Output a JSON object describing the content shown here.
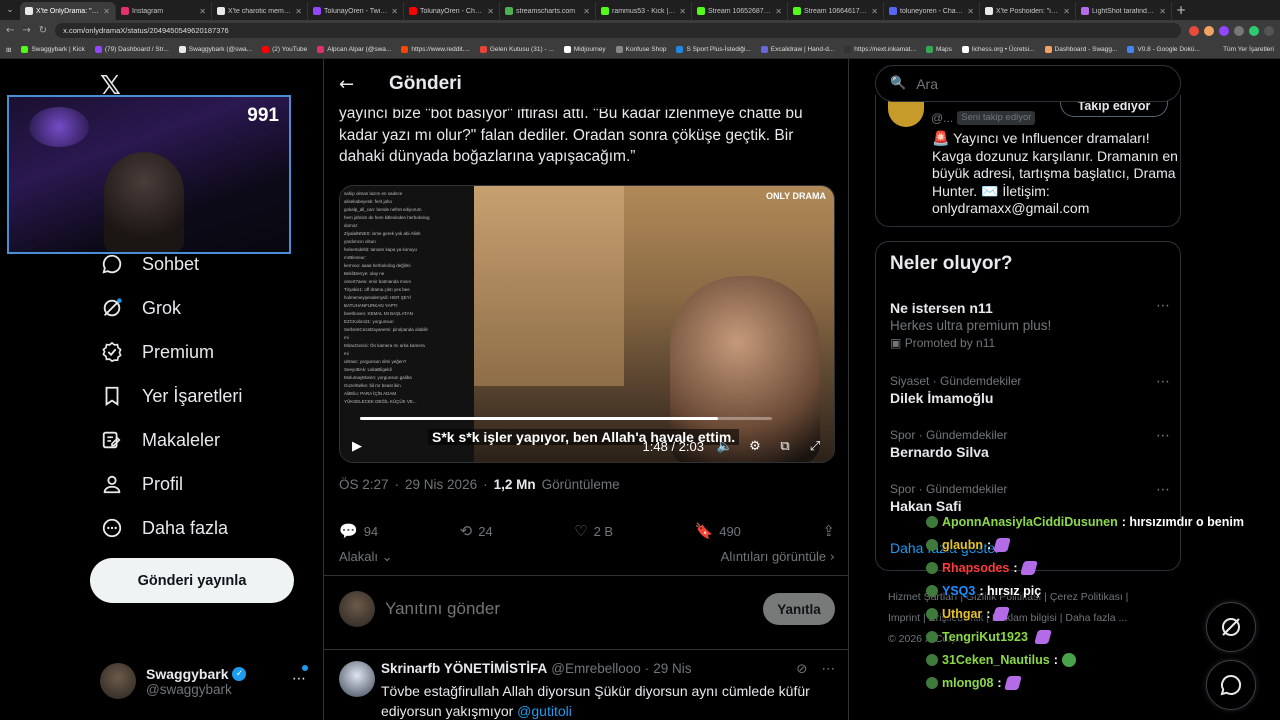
{
  "browser": {
    "tabs": [
      {
        "title": "X'te OnlyDrama: \"Tolu...",
        "color": "#e7e9ea",
        "active": true
      },
      {
        "title": "Instagram",
        "color": "#e1306c"
      },
      {
        "title": "X'te charotic memesi \"P...",
        "color": "#e7e9ea"
      },
      {
        "title": "TolunayOren - Twitch",
        "color": "#9146ff"
      },
      {
        "title": "TolunayOren - Channel",
        "color": "#ff0000"
      },
      {
        "title": "streamscharts.com",
        "color": "#4caf50"
      },
      {
        "title": "rammus53 - Kick | Stre...",
        "color": "#53fc18"
      },
      {
        "title": "Stream 106526878 - ul...",
        "color": "#53fc18"
      },
      {
        "title": "Stream 106646173 - bi...",
        "color": "#53fc18"
      },
      {
        "title": "toluneyoren - Channel",
        "color": "#5865f2"
      },
      {
        "title": "X'te Poshoiden: \"izmir...",
        "color": "#e7e9ea"
      },
      {
        "title": "LightShot tarafindan li...",
        "color": "#b46be8"
      }
    ],
    "url": "x.com/onlydramaX/status/2049450549620187376",
    "bookmarks": [
      {
        "label": "Swaggybark | Kick",
        "color": "#53fc18"
      },
      {
        "label": "(79) Dashboard / Str...",
        "color": "#9146ff"
      },
      {
        "label": "Swaggybark (@swa...",
        "color": "#e7e9ea"
      },
      {
        "label": "(2) YouTube",
        "color": "#ff0000"
      },
      {
        "label": "Alpcan Alpar (@swa...",
        "color": "#e1306c"
      },
      {
        "label": "https://www.reddit....",
        "color": "#ff4500"
      },
      {
        "label": "Gelen Kutusu (31) - ...",
        "color": "#ea4335"
      },
      {
        "label": "Midjourney",
        "color": "#ffffff"
      },
      {
        "label": "Konfuse Shop",
        "color": "#888888"
      },
      {
        "label": "S Sport Plus-İstediği...",
        "color": "#1e88e5"
      },
      {
        "label": "Excalidraw | Hand-d...",
        "color": "#6965db"
      },
      {
        "label": "https://next.inkamat...",
        "color": "#333333"
      },
      {
        "label": "Maps",
        "color": "#34a853"
      },
      {
        "label": "lichess.org • Ücretsi...",
        "color": "#ffffff"
      },
      {
        "label": "Dashboard - Swagg...",
        "color": "#f4a261"
      },
      {
        "label": "V0.8 - Google Dokü...",
        "color": "#4285f4"
      }
    ],
    "all_bookmarks": "Tüm Yer İşaretleri"
  },
  "webcam": {
    "viewer_count": "991"
  },
  "nav": {
    "items": [
      {
        "label": "Sohbet",
        "icon": "chat-icon"
      },
      {
        "label": "Grok",
        "icon": "grok-icon"
      },
      {
        "label": "Premium",
        "icon": "premium-icon"
      },
      {
        "label": "Yer İşaretleri",
        "icon": "bookmark-icon"
      },
      {
        "label": "Makaleler",
        "icon": "articles-icon"
      },
      {
        "label": "Profil",
        "icon": "profile-icon"
      },
      {
        "label": "Daha fazla",
        "icon": "more-icon"
      }
    ],
    "post_button": "Gönderi yayınla",
    "account": {
      "name": "Swaggybark",
      "handle": "@swaggybark"
    }
  },
  "main": {
    "title": "Gönderi",
    "tweet_text": "yayıncı bize \"bot basıyor\" iftirası attı. \"Bu kadar izlenmeye chatte bu kadar yazı mı olur?\" falan dediler. Oradan sonra çöküşe geçtik. Bir dahaki dünyada boğazlarına yapışacağım.”",
    "video": {
      "subtitle": "S*k s*k işler yapıyor, ben Allah'a havale ettim.",
      "time": "1:48 / 2:03",
      "progress": 0.87,
      "logo": "ONLY DRAMA",
      "chat_lines": [
        "sahip olman lazım en sadece",
        "alisekabeyesk: ferit jaho",
        "gokalp_all_can: bende nefret ediyorum",
        "hem jahnim de hem kitlesinden herbokolog",
        "domoz",
        "ZiyalalNNES: isme gerek yok abi Allah",
        "yardımcın olsun",
        "heisemdeltit: tamam kapa ya konuyu",
        "mrBleneur:",
        "kerrvoo: aaaa herbokolog değilmi",
        "BekliDerrye: olay ne",
        "omert7aew: emir batmanda mısın",
        "Tiryakis1: off drama çıktı yes bee",
        "holmemeyşendemyüli: HER ŞEYİ",
        "BATUHANFURKAN YAPTI",
        "beethoven: KEMAL MI BAŞLATAN",
        "EZCKobro31: yorgunsun",
        "SerbestCezaDayanemi: pirolpanda olabilir",
        "mi",
        "MiracGecisi: Ön kamera mı arka kamera",
        "mi",
        "ultrasc: yorgunsun dimi yeğen?",
        "SeeyoBAk: LakaBligeldi",
        "MolumayMoren: yorgunsun galiba",
        "GozelSelke: bil mr beast ikin",
        "AlitElio: PARA İÇİN ADAM",
        "YÜKSELECEK DEĞİL KÜÇÜK VE..."
      ]
    },
    "meta": {
      "time": "ÖS 2:27",
      "date": "29 Nis 2026",
      "views": "1,2 Mn",
      "views_label": "Görüntüleme"
    },
    "actions": {
      "replies": "94",
      "reposts": "24",
      "likes": "2 B",
      "bookmarks": "490"
    },
    "sort_label": "Alakalı",
    "quotes_label": "Alıntıları görüntüle",
    "reply_placeholder": "Yanıtını gönder",
    "reply_button": "Yanıtla",
    "reply_tweet": {
      "name": "Skrinarfb YÖNETİMİSTİFA",
      "handle": "@Emrebellooo",
      "time": "29 Nis",
      "text_a": "Tövbe estağfirullah Allah diyorsun Şükür diyorsun aynı cümlede küfür ediyorsun yakışmıyor ",
      "mention": "@gutitoli"
    }
  },
  "right": {
    "search_placeholder": "Ara",
    "profile": {
      "handle": "@...",
      "badge": "Seni takip ediyor",
      "follow_label": "Takip ediyor",
      "bio_lines": [
        "🚨 Yayıncı ve Influencer dramaları!",
        "Kavga dozunuz karşılanır. Dramanın en",
        "büyük adresi, tartışma başlatıcı, Drama",
        "Hunter. ✉️ İletişim:",
        "onlydramaxx@gmail.com"
      ]
    },
    "trends_title": "Neler oluyor?",
    "trends": [
      {
        "category": "",
        "name": "Ne istersen n11",
        "sub": "Herkes ultra premium plus!",
        "promo": "Promoted by n11"
      },
      {
        "category": "Siyaset · Gündemdekiler",
        "name": "Dilek İmamoğlu"
      },
      {
        "category": "Spor · Gündemdekiler",
        "name": "Bernardo Silva"
      },
      {
        "category": "Spor · Gündemdekiler",
        "name": "Hakan Safi"
      }
    ],
    "show_more": "Daha fazla göster",
    "footer": {
      "line1": "Hizmet Şartları  |  Gizlilik Politikası  |  Çerez Politikası  |",
      "line2": "Imprint  |  Erişilebilirlik  |  Reklam bilgisi  |  Daha fazla ...",
      "line3": "© 2026 X Corp."
    }
  },
  "stream_chat": [
    {
      "user": "AponnAnasiylaCiddiDusunen",
      "color": "#8bd94a",
      "msg": ": hırsızımdır o benim",
      "emote": ""
    },
    {
      "user": "glaubn",
      "color": "#e6c229",
      "msg": ":",
      "emote": "purple"
    },
    {
      "user": "Rhapsodes",
      "color": "#ff3b3b",
      "msg": ":",
      "emote": "purple"
    },
    {
      "user": "YSQ3",
      "color": "#1e90ff",
      "msg": ": hırsız piç",
      "emote": ""
    },
    {
      "user": "Uthgar",
      "color": "#e6c229",
      "msg": ":",
      "emote": "purple"
    },
    {
      "user": "TengriKut1923",
      "color": "#8bd94a",
      "msg": "",
      "emote": "purple"
    },
    {
      "user": "31Ceken_Nautilus",
      "color": "#8bd94a",
      "msg": ":",
      "emote": "green"
    },
    {
      "user": "mlong08",
      "color": "#8bd94a",
      "msg": ":",
      "emote": "purple"
    }
  ]
}
